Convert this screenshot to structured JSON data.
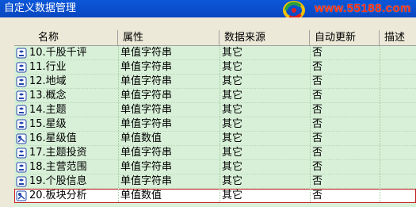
{
  "window": {
    "title": "自定义数据管理",
    "watermark_url": "www.55188.com"
  },
  "table": {
    "columns": [
      "名称",
      "属性",
      "数据来源",
      "自动更新",
      "描述"
    ],
    "rows": [
      {
        "name": "10.千股千评",
        "attr": "单值字符串",
        "source": "其它",
        "auto": "否",
        "desc": "",
        "icon": "text-field-icon"
      },
      {
        "name": "11.行业",
        "attr": "单值字符串",
        "source": "其它",
        "auto": "否",
        "desc": "",
        "icon": "text-field-icon"
      },
      {
        "name": "12.地域",
        "attr": "单值字符串",
        "source": "其它",
        "auto": "否",
        "desc": "",
        "icon": "text-field-icon"
      },
      {
        "name": "13.概念",
        "attr": "单值字符串",
        "source": "其它",
        "auto": "否",
        "desc": "",
        "icon": "text-field-icon"
      },
      {
        "name": "14.主题",
        "attr": "单值字符串",
        "source": "其它",
        "auto": "否",
        "desc": "",
        "icon": "text-field-icon"
      },
      {
        "name": "15.星级",
        "attr": "单值字符串",
        "source": "其它",
        "auto": "否",
        "desc": "",
        "icon": "text-field-icon"
      },
      {
        "name": "16.星级值",
        "attr": "单值数值",
        "source": "其它",
        "auto": "否",
        "desc": "",
        "icon": "number-field-icon"
      },
      {
        "name": "17.主题投资",
        "attr": "单值字符串",
        "source": "其它",
        "auto": "否",
        "desc": "",
        "icon": "text-field-icon"
      },
      {
        "name": "18.主营范围",
        "attr": "单值字符串",
        "source": "其它",
        "auto": "否",
        "desc": "",
        "icon": "text-field-icon"
      },
      {
        "name": "19.个股信息",
        "attr": "单值字符串",
        "source": "其它",
        "auto": "否",
        "desc": "",
        "icon": "text-field-icon"
      },
      {
        "name": "20.板块分析",
        "attr": "单值数值",
        "source": "其它",
        "auto": "否",
        "desc": "",
        "icon": "number-field-icon",
        "selected": true
      }
    ]
  },
  "colors": {
    "title_bar": "#0b57d9",
    "grid_background": "#d8f0d8",
    "selection_outline": "#c02020",
    "watermark": "#ff2a00"
  }
}
